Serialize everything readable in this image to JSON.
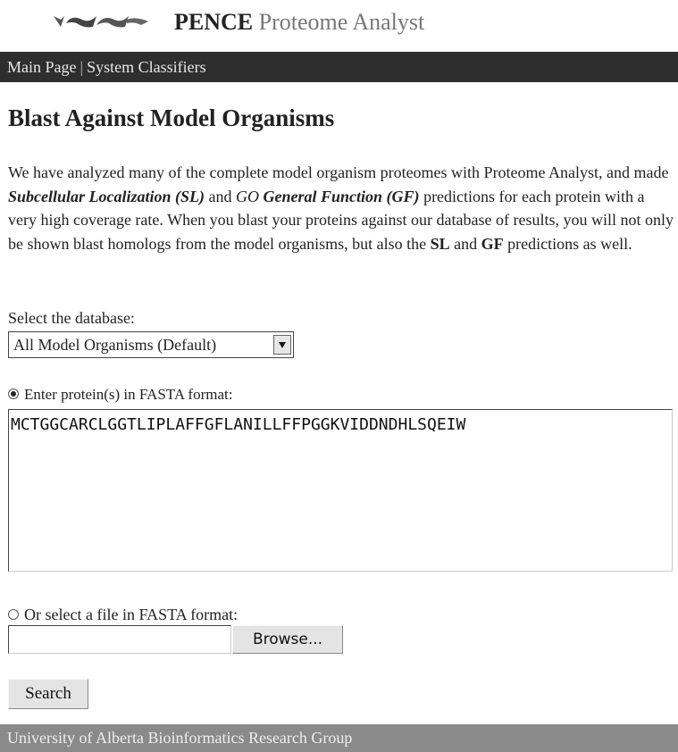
{
  "header": {
    "logo_icon": "pence-logo-icon",
    "brand_bold": "PENCE",
    "brand_rest": "Proteome Analyst"
  },
  "nav": {
    "items": [
      {
        "label": "Main Page"
      },
      {
        "label": "System Classifiers"
      }
    ],
    "separator": "|"
  },
  "page": {
    "title": "Blast Against Model Organisms",
    "description": {
      "p1": "We have analyzed many of the complete model organism proteomes with Proteome Analyst, and made ",
      "sl": "Subcellular Localization (SL)",
      "and1": " and ",
      "go": "GO",
      "gf": "General Function (GF)",
      "p2": " predictions for each protein with a very high coverage rate. When you blast your proteins against our database of results, you will not only be shown blast homologs from the model organisms, but also the ",
      "sl_short": "SL",
      "and2": " and ",
      "gf_short": "GF",
      "p3": " predictions as well."
    }
  },
  "form": {
    "db_label": "Select the database:",
    "db_selected": "All Model Organisms (Default)",
    "radio_fasta_label": "Enter protein(s) in FASTA format:",
    "radio_fasta_checked": true,
    "fasta_value": "MCTGGCARCLGGTLIPLAFFGFLANILLFFPGGKVIDDNDHLSQEIW",
    "radio_file_label": "Or select a file in FASTA format:",
    "radio_file_checked": false,
    "file_value": "",
    "browse_label": "Browse...",
    "search_label": "Search"
  },
  "footer": {
    "text": "University of Alberta Bioinformatics Research Group"
  },
  "colors": {
    "navbar_bg": "#2e2e2e",
    "footer_bg": "#8a8a8a",
    "brand_gray": "#777777"
  }
}
